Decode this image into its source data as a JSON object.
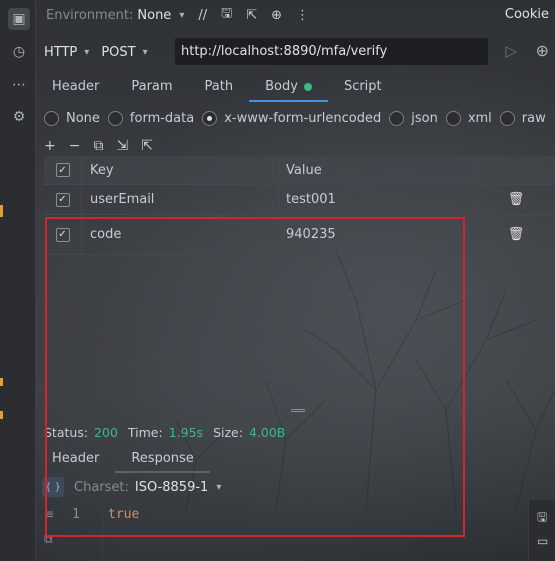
{
  "topbar": {
    "env_label": "Environment:",
    "env_value": "None",
    "cookie": "Cookie"
  },
  "request": {
    "protocol": "HTTP",
    "method": "POST",
    "url": "http://localhost:8890/mfa/verify"
  },
  "tabs": [
    "Header",
    "Param",
    "Path",
    "Body",
    "Script"
  ],
  "body_types": [
    {
      "label": "None",
      "selected": false
    },
    {
      "label": "form-data",
      "selected": false
    },
    {
      "label": "x-www-form-urlencoded",
      "selected": true
    },
    {
      "label": "json",
      "selected": false
    },
    {
      "label": "xml",
      "selected": false
    },
    {
      "label": "raw",
      "selected": false
    }
  ],
  "table": {
    "headers": {
      "key": "Key",
      "value": "Value"
    },
    "rows": [
      {
        "key": "userEmail",
        "value": "test001",
        "checked": true
      },
      {
        "key": "code",
        "value": "940235",
        "checked": true
      }
    ]
  },
  "status": {
    "status_label": "Status:",
    "status_value": "200",
    "time_label": "Time:",
    "time_value": "1.95s",
    "size_label": "Size:",
    "size_value": "4.00B"
  },
  "response_tabs": [
    "Header",
    "Response"
  ],
  "response": {
    "charset_label": "Charset:",
    "charset_value": "ISO-8859-1",
    "line_number": "1",
    "body": "true"
  },
  "colors": {
    "accent": "#4a8fe7",
    "success": "#3fb886",
    "highlight_box": "#d3262b"
  }
}
